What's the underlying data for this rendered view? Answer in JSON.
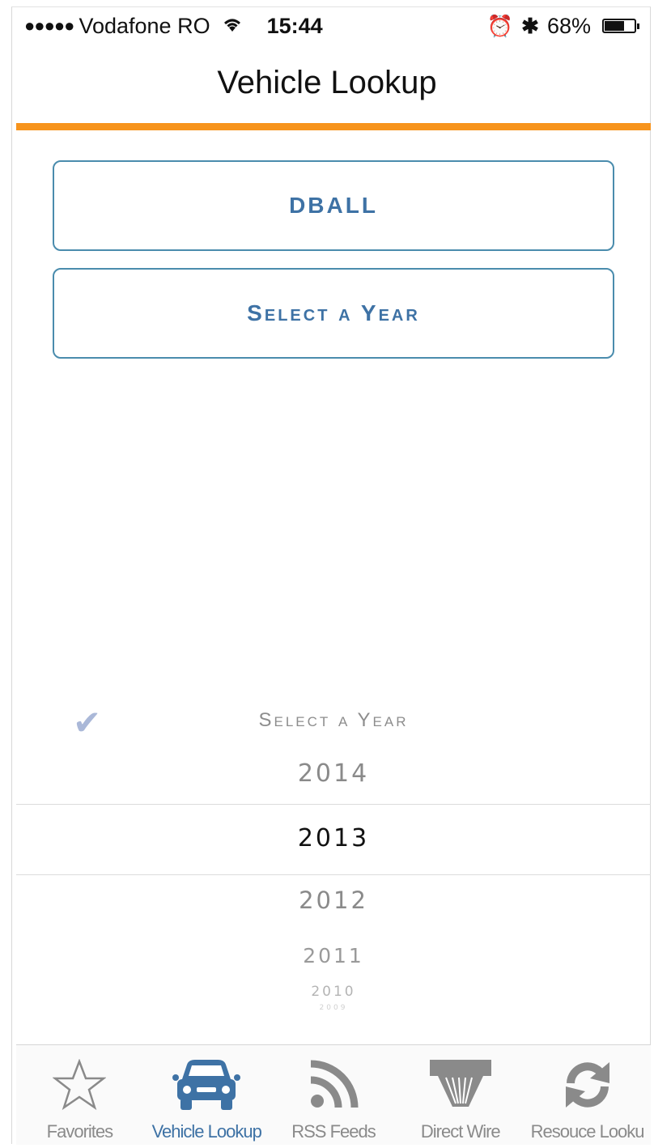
{
  "status_bar": {
    "signal_dots": "●●●●●",
    "carrier": "Vodafone RO",
    "wifi_icon": "wifi-icon",
    "time": "15:44",
    "alarm_icon": "⏰",
    "bluetooth_icon": "✱",
    "battery": "68%",
    "battery_level": 0.68
  },
  "nav": {
    "title": "Vehicle Lookup"
  },
  "buttons": {
    "make": "DBALL",
    "year": "Select a Year"
  },
  "picker": {
    "check_icon": "✔",
    "title": "Select a Year",
    "years": [
      "2014",
      "2013",
      "2012",
      "2011",
      "2010",
      "2009"
    ],
    "selected": "2013"
  },
  "tabs": [
    {
      "label": "Favorites",
      "icon": "star-icon"
    },
    {
      "label": "Vehicle Lookup",
      "icon": "car-icon"
    },
    {
      "label": "RSS Feeds",
      "icon": "rss-icon"
    },
    {
      "label": "Direct Wire",
      "icon": "wire-icon"
    },
    {
      "label": "Resouce Looku",
      "icon": "refresh-icon"
    }
  ],
  "colors": {
    "accent_orange": "#f7941d",
    "button_blue": "#3e72a5",
    "border_blue": "#4a8cad"
  }
}
